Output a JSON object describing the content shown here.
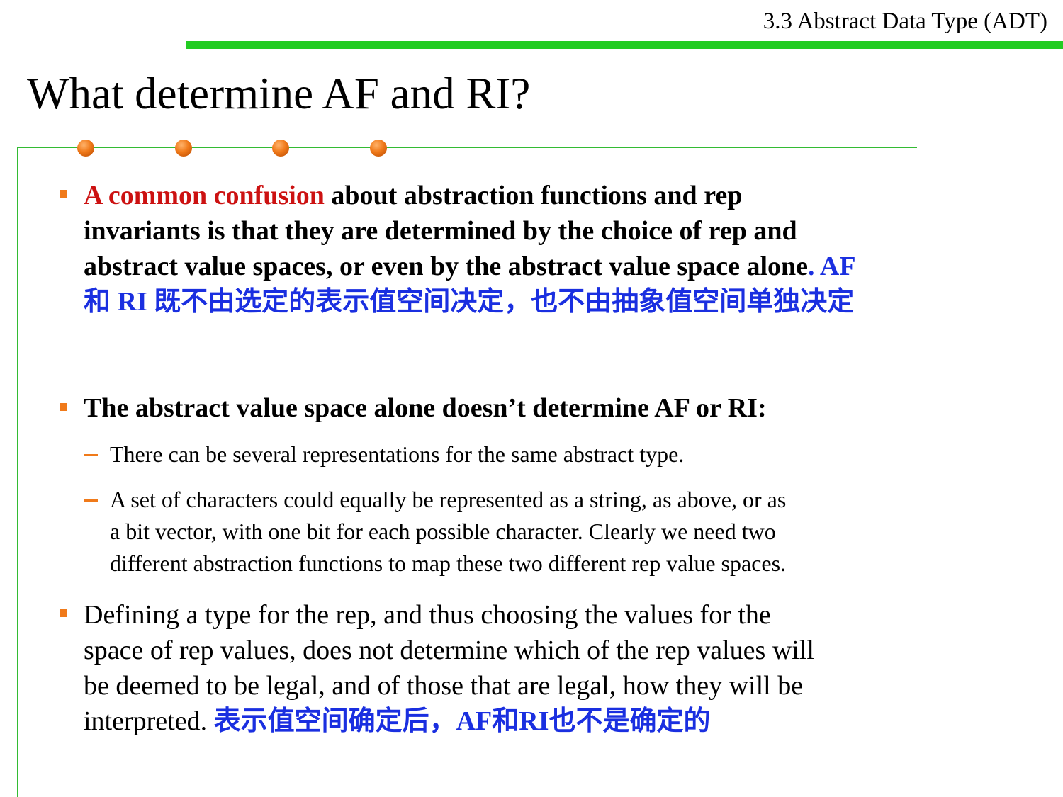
{
  "header": {
    "section": "3.3 Abstract Data Type (ADT)",
    "title": "What determine AF and RI?"
  },
  "colors": {
    "accent_green": "#22cc22",
    "bullet_orange": "#f07a1a",
    "highlight_red": "#cc1111",
    "highlight_blue": "#1a2fe0"
  },
  "content": {
    "b1": {
      "red": "A common confusion",
      "l1": " about abstraction functions and rep",
      "l2": "invariants is that they are determined by the choice of rep and",
      "l3": "abstract value spaces, or even by the abstract value space alone",
      "blue1": ". AF",
      "blue2": "和 RI 既不由选定的表示值空间决定，也不由抽象值空间单独决定"
    },
    "b2": {
      "text": "The abstract value space alone doesn’t determine AF or RI:"
    },
    "s1": {
      "text": "There can be several representations for the same abstract type."
    },
    "s2": {
      "l1": "A set of characters could equally be represented as a string, as above, or as",
      "l2": "a bit vector, with one bit for each possible character. Clearly we need two",
      "l3": "different abstraction functions to map these two different rep value spaces."
    },
    "b3": {
      "l1": "Defining a type for the rep, and thus choosing the values for the",
      "l2": "space of rep values, does not determine which of the rep values will",
      "l3": "be deemed to be legal, and of those that are legal, how they will be",
      "l4": "interpreted.  ",
      "blue": "表示值空间确定后，AF和RI也不是确定的"
    }
  }
}
